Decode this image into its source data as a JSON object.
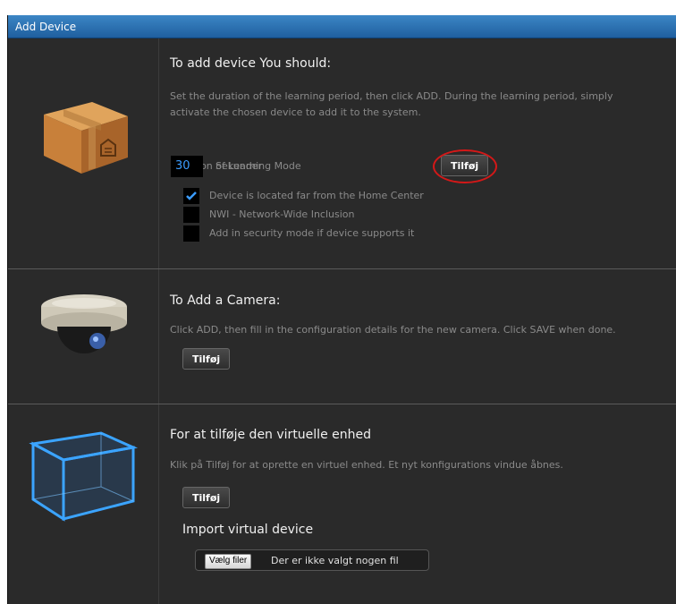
{
  "window": {
    "title": "Add Device"
  },
  "device_section": {
    "heading": "To add device You should:",
    "description": "Set the duration of the learning period, then click ADD. During the learning period, simply activate the chosen device to add it to the system.",
    "duration_label": "Duration of Learning Mode",
    "duration_value": "30",
    "unit_label": "Sekunder",
    "add_button": "Tilføj",
    "options": [
      {
        "label": "Device is located far from the Home Center",
        "checked": true
      },
      {
        "label": "NWI - Network-Wide Inclusion",
        "checked": false
      },
      {
        "label": "Add in security mode if device supports it",
        "checked": false
      }
    ],
    "icon": "package-box-icon"
  },
  "camera_section": {
    "heading": "To Add a Camera:",
    "description": "Click ADD, then fill in the configuration details for the new camera. Click SAVE when done.",
    "add_button": "Tilføj",
    "icon": "dome-camera-icon"
  },
  "virtual_section": {
    "heading": "For at tilføje den virtuelle enhed",
    "description": "Klik på Tilføj for at oprette en virtuel enhed. Et nyt konfigurations vindue åbnes.",
    "add_button": "Tilføj",
    "import_heading": "Import virtual device",
    "file_button": "Vælg filer",
    "file_status": "Der er ikke valgt nogen fil",
    "icon": "wireframe-cube-icon"
  },
  "colors": {
    "titlebar": "#2a70b0",
    "panel_background": "#2a2a2a",
    "accent_blue": "#3b9cff",
    "highlight_ring": "#d41818"
  }
}
